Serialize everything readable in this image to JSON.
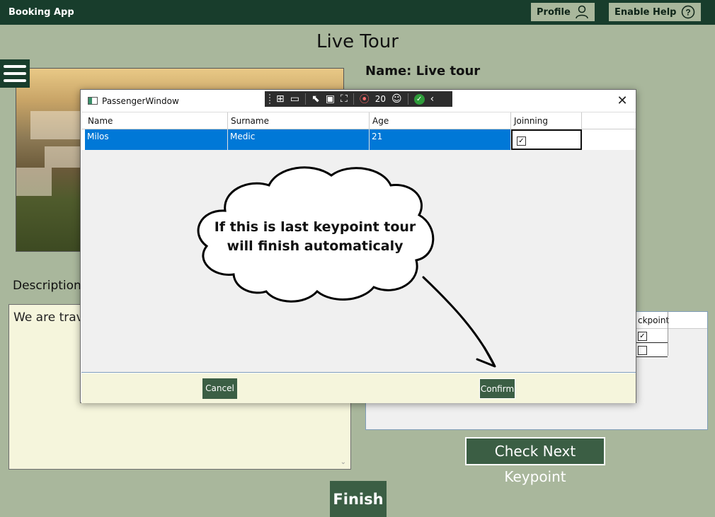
{
  "app": {
    "name": "Booking App"
  },
  "header": {
    "profile_label": "Profile",
    "help_label": "Enable Help"
  },
  "page": {
    "title": "Live Tour"
  },
  "tour": {
    "name_label": "Name: Live tour",
    "description_label": "Description:",
    "description_text": "We are trave"
  },
  "keypoints": {
    "column_fragment": "ckpoint",
    "rows": [
      {
        "checked": true
      },
      {
        "checked": false
      }
    ]
  },
  "buttons": {
    "check_next_keypoint": "Check Next Keypoint",
    "finish": "Finish"
  },
  "dialog": {
    "title": "PassengerWindow",
    "debug_counter": "20",
    "columns": [
      "Name",
      "Surname",
      "Age",
      "Joinning"
    ],
    "rows": [
      {
        "name": "Milos",
        "surname": "Medic",
        "age": "21",
        "joining": true
      }
    ],
    "cancel_label": "Cancel",
    "confirm_label": "Confirm"
  },
  "callout": {
    "line1": "If this is last keypoint tour",
    "line2": "will finish automaticaly"
  },
  "icons": {
    "profile": "person-icon",
    "help": "question-circle-icon",
    "menu": "hamburger-icon",
    "close": "close-icon"
  },
  "colors": {
    "titlebar": "#183d2c",
    "background": "#a9b79c",
    "button": "#3b5e44",
    "selection": "#0078d7",
    "panel": "#f5f5dc"
  }
}
